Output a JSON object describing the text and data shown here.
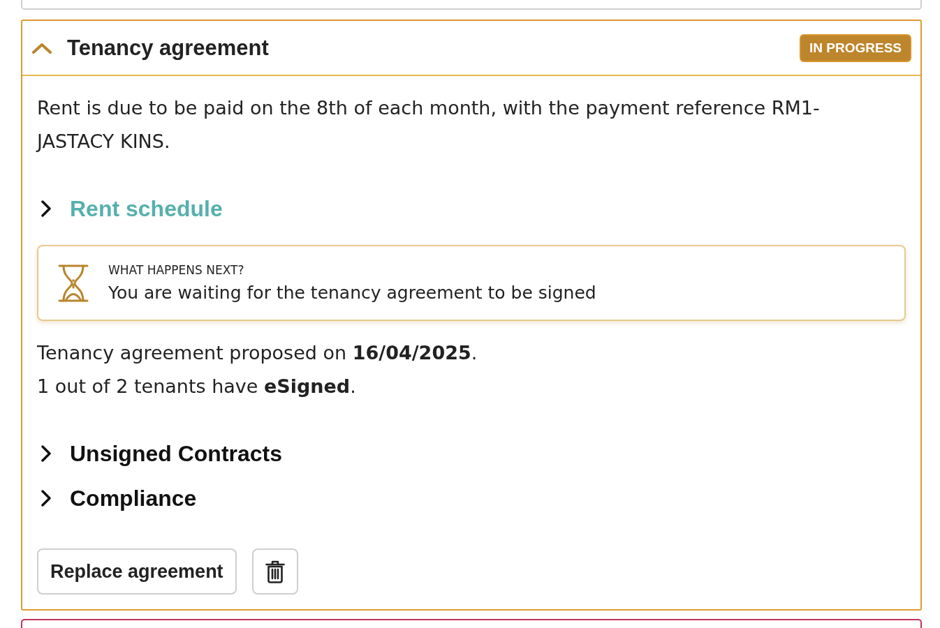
{
  "section": {
    "title": "Tenancy agreement",
    "expanded": true,
    "status": {
      "label": "IN PROGRESS",
      "kind": "in_progress"
    }
  },
  "intro": "Rent is due to be paid on the 8th of each month, with the payment reference RM1-JASTACY KINS.",
  "rent_schedule": {
    "label": "Rent schedule",
    "expanded": false
  },
  "next_step": {
    "heading": "WHAT HAPPENS NEXT?",
    "message": "You are waiting for the tenancy agreement to be signed"
  },
  "details": [
    "Tenancy agreement proposed on **16/04/2025**.",
    "1 out of 2 tenants have **eSigned**."
  ],
  "subsections": [
    {
      "label": "Unsigned Contracts",
      "expanded": false
    },
    {
      "label": "Compliance",
      "expanded": false
    }
  ],
  "actions": [
    {
      "kind": "text",
      "label": "Replace agreement"
    },
    {
      "kind": "delete"
    }
  ]
}
